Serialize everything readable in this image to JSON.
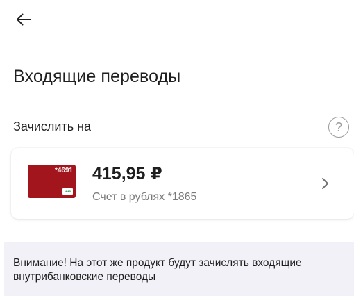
{
  "header": {
    "back_icon": "arrow-left-icon",
    "title": "Входящие переводы"
  },
  "credit_section": {
    "label": "Зачислить на",
    "help_icon": "question-circle-icon",
    "help_glyph": "?"
  },
  "account": {
    "card_number": "*4691",
    "card_brand": "МИР",
    "card_color": "#a3151d",
    "amount": "415,95 ₽",
    "subtitle": "Счет в рублях *1865",
    "chevron_icon": "chevron-right-icon"
  },
  "notice": {
    "text": "Внимание! На этот же продукт будут зачислять входящие внутрибанковские переводы",
    "background": "#f1f1f7"
  }
}
